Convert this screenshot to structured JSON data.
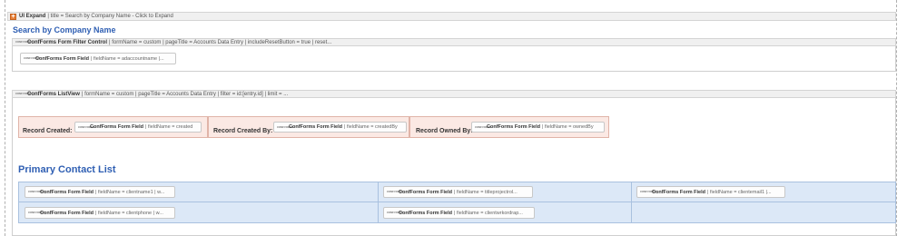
{
  "expand": {
    "name": "UI Expand",
    "params": "| title = Search by Company Name - Click to Expand"
  },
  "search_heading": "Search by Company Name",
  "filter_control": {
    "name": "ConfForms Form Filter Control",
    "params": "| formName = custom | pageTitle = Accounts Data Entry | includeResetButton = true | reset..."
  },
  "filter_field": {
    "name": "ConfForms Form Field",
    "params": "| fieldName = adaccountname |..."
  },
  "listview": {
    "name": "ConfForms ListView",
    "params": "| formName = custom | pageTitle = Accounts Data Entry | filter = id:[entry.id] | limit = ..."
  },
  "icon_text": "CONF FORMS",
  "records": [
    {
      "label": "Record Created:",
      "field_name": "ConfForms Form Field",
      "field_params": "| fieldName = created"
    },
    {
      "label": "Record Created By:",
      "field_name": "ConfForms Form Field",
      "field_params": "| fieldName = createdBy"
    },
    {
      "label": "Record Owned By:",
      "field_name": "ConfForms Form Field",
      "field_params": "| fieldName = ownedBy"
    }
  ],
  "contact_heading": "Primary Contact List",
  "contact_rows": [
    [
      {
        "name": "ConfForms Form Field",
        "params": "| fieldName = clientname1 | w..."
      },
      {
        "name": "ConfForms Form Field",
        "params": "| fieldName = titleprojectrol..."
      },
      {
        "name": "ConfForms Form Field",
        "params": "| fieldName = clientemail1 |..."
      }
    ],
    [
      {
        "name": "ConfForms Form Field",
        "params": "| fieldName = clientphone | w..."
      },
      {
        "name": "ConfForms Form Field",
        "params": "| fieldName = clientwrkordrap..."
      }
    ]
  ]
}
